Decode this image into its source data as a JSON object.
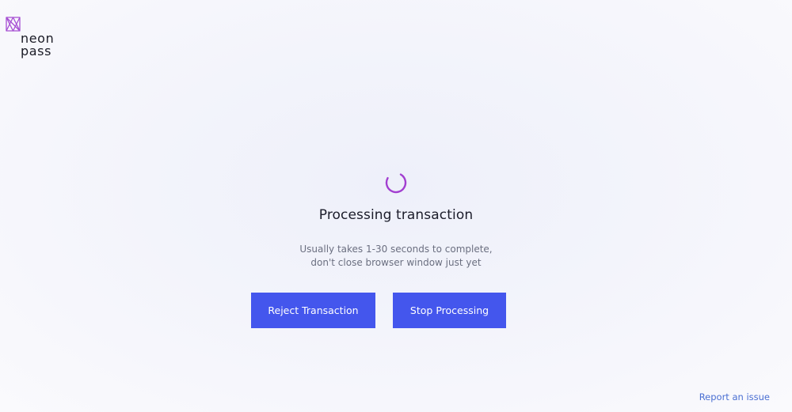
{
  "brand": {
    "name_line1": "neon",
    "name_line2": "pass",
    "icon": "neonpass-logo-icon",
    "logo_color": "#a64fd3"
  },
  "status": {
    "spinner_icon": "loading-spinner-icon",
    "spinner_color": "#a23fd0",
    "title": "Processing transaction",
    "subtitle_line1": "Usually takes 1-30 seconds to complete,",
    "subtitle_line2": "don't close browser window just yet"
  },
  "actions": {
    "reject_label": "Reject Transaction",
    "stop_label": "Stop Processing",
    "button_color": "#4456ed"
  },
  "footer": {
    "report_link": "Report an issue",
    "link_color": "#4a6fd2"
  }
}
